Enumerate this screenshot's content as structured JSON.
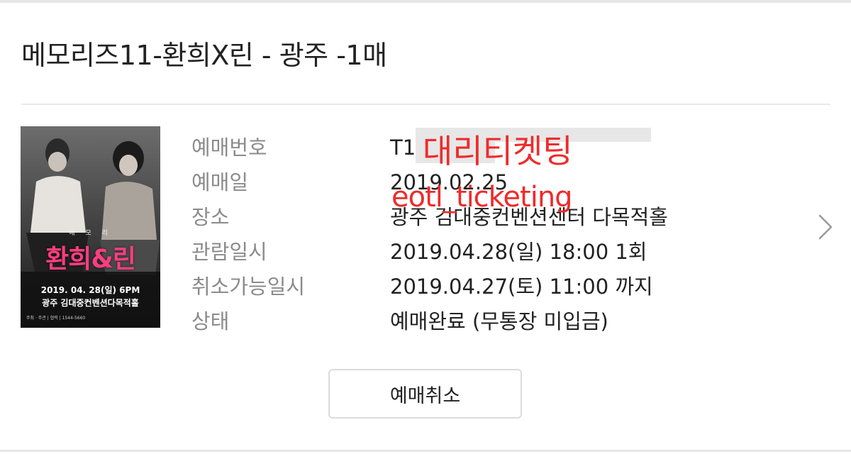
{
  "title": "메모리즈11-환희X린 - 광주 -1매",
  "poster": {
    "subtitle": "메 모 리",
    "headline": "환희&린",
    "date": "2019. 04. 28(일) 6PM",
    "venue": "광주 김대중컨벤션다목적홀",
    "footer": "주최 · 주관 |  협력 |  1544-5660"
  },
  "details": [
    {
      "label": "예매번호",
      "value": "T1"
    },
    {
      "label": "예매일",
      "value": "2019.02.25"
    },
    {
      "label": "장소",
      "value": "광주 김대중컨벤션센터 다목적홀"
    },
    {
      "label": "관람일시",
      "value": "2019.04.28(일) 18:00 1회"
    },
    {
      "label": "취소가능일시",
      "value": "2019.04.27(토) 11:00 까지"
    },
    {
      "label": "상태",
      "value": "예매완료 (무통장 미입금)"
    }
  ],
  "watermark": {
    "korean": "대리티켓팅",
    "english": "eotl_ticketing",
    "color": "#ef2b2b"
  },
  "actions": {
    "cancel_label": "예매취소"
  },
  "icons": {
    "detail_arrow": "chevron-right-icon"
  }
}
